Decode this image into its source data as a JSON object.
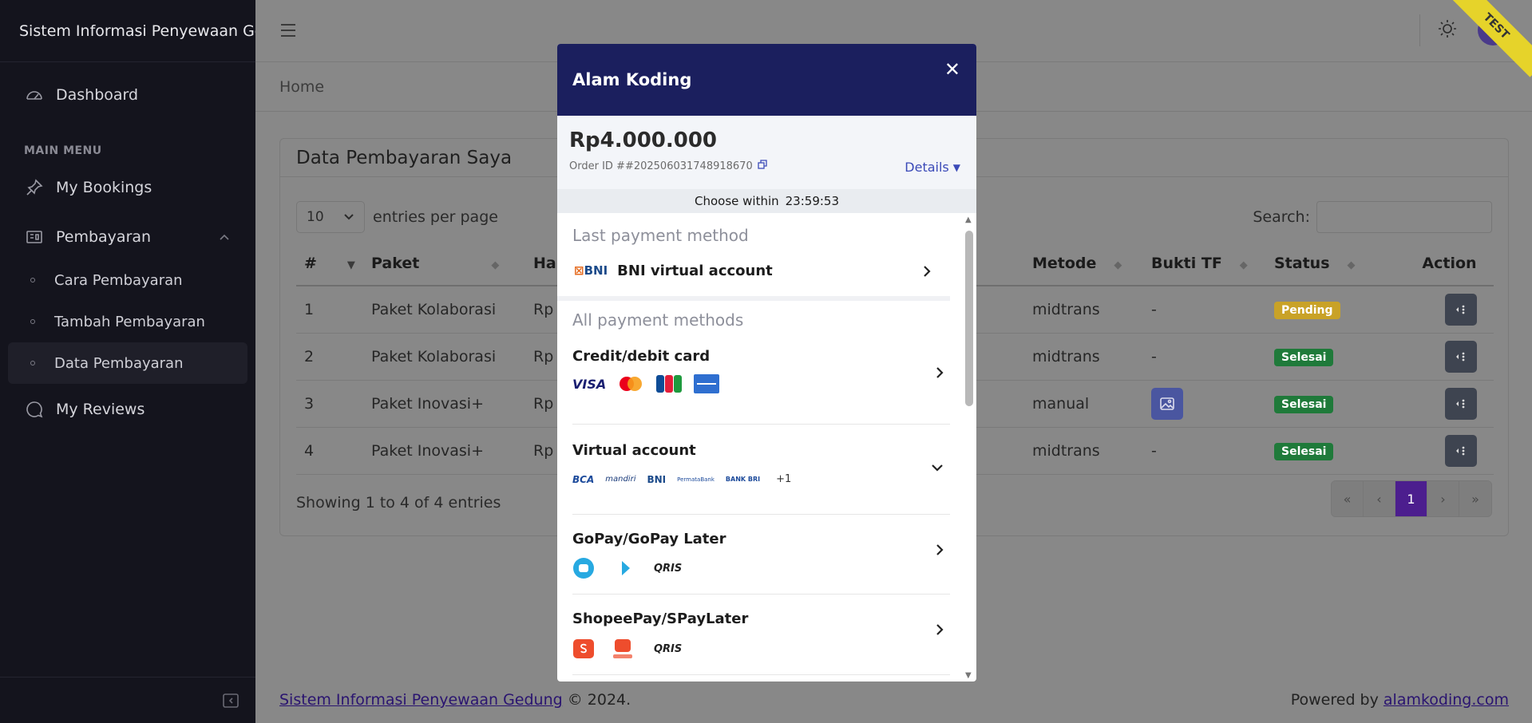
{
  "app": {
    "brand": "Sistem Informasi Penyewaan Gedung"
  },
  "sidebar": {
    "dashboard": "Dashboard",
    "section": "MAIN MENU",
    "bookings": "My Bookings",
    "pembayaran": "Pembayaran",
    "sub": [
      "Cara Pembayaran",
      "Tambah Pembayaran",
      "Data Pembayaran"
    ],
    "reviews": "My Reviews"
  },
  "breadcrumb": "Home",
  "card": {
    "title": "Data Pembayaran Saya",
    "entries_value": "10",
    "entries_label": "entries per page",
    "search_label": "Search:",
    "headers": [
      "#",
      "Paket",
      "Ha",
      "Metode",
      "Bukti TF",
      "Status",
      "Action"
    ],
    "rows": [
      {
        "no": "1",
        "paket": "Paket Kolaborasi",
        "ha": "Rp",
        "metode": "midtrans",
        "bukti": "-",
        "status": "Pending"
      },
      {
        "no": "2",
        "paket": "Paket Kolaborasi",
        "ha": "Rp",
        "metode": "midtrans",
        "bukti": "-",
        "status": "Selesai"
      },
      {
        "no": "3",
        "paket": "Paket Inovasi+",
        "ha": "Rp",
        "metode": "manual",
        "bukti": "",
        "status": "Selesai"
      },
      {
        "no": "4",
        "paket": "Paket Inovasi+",
        "ha": "Rp",
        "metode": "midtrans",
        "bukti": "-",
        "status": "Selesai"
      }
    ],
    "showing": "Showing 1 to 4 of 4 entries",
    "pager": [
      "«",
      "‹",
      "1",
      "›",
      "»"
    ]
  },
  "footer": {
    "link": "Sistem Informasi Penyewaan Gedung",
    "copy": "© 2024.",
    "powered": "Powered by",
    "powered_link": "alamkoding.com"
  },
  "ribbon": "TEST",
  "colors": {
    "pending": "#c9a227",
    "selesai": "#1f7a3a",
    "modal_header": "#1b1f5e",
    "accent": "#4c1e8e"
  },
  "modal": {
    "title": "Alam Koding",
    "amount": "Rp4.000.000",
    "order_id": "Order ID ##202506031748918670",
    "details": "Details",
    "timer_label": "Choose within",
    "timer": "23:59:53",
    "last_title": "Last payment method",
    "last_method": "BNI virtual account",
    "all_title": "All payment methods",
    "methods": [
      {
        "name": "Credit/debit card",
        "logos": [
          "VISA",
          "mastercard",
          "JCB",
          "AMEX"
        ]
      },
      {
        "name": "Virtual account",
        "logos": [
          "BCA",
          "mandiri",
          "BNI",
          "PermataBank",
          "BANK BRI",
          "+1"
        ]
      },
      {
        "name": "GoPay/GoPay Later",
        "logos": [
          "gopay",
          "gopaylater",
          "QRIS"
        ]
      },
      {
        "name": "ShopeePay/SPayLater",
        "logos": [
          "shopeepay",
          "SPayLater",
          "QRIS"
        ]
      }
    ]
  }
}
